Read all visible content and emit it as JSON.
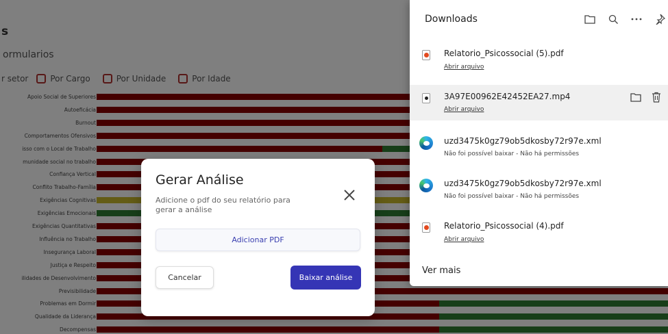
{
  "app": {
    "title": "s",
    "subtitle": "ormularios",
    "filters": [
      "r setor",
      "Por Cargo",
      "Por Unidade",
      "Por Idade"
    ]
  },
  "chart_data": {
    "type": "bar",
    "orientation": "horizontal",
    "stacked": true,
    "categories": [
      "Apoio Social de Superiores",
      "Autoeficácia",
      "Burnout",
      "Comportamentos Ofensivos",
      "isso com o Local de Trabalho",
      "munidade social no trabalho",
      "Confiança Vertical",
      "Conflito Trabalho-Família",
      "Exigências Cognitivas",
      "Exigências Emocionais",
      "Exigências Quantitativas",
      "Influência no Trabalho",
      "Insegurança Laboral",
      "Justiça e Respeito",
      "ilidades de Desenvolvimento",
      "Previsibilidade",
      "Problemas em Dormir",
      "Qualidade da Liderança",
      "Decompensas"
    ],
    "series": [
      {
        "color": "#8b0000",
        "values": [
          1,
          1,
          1,
          1,
          0.5,
          1,
          1,
          1,
          0,
          0,
          1,
          1,
          1,
          1,
          1,
          1,
          0.6,
          0.6,
          0.6
        ]
      },
      {
        "color": "#2e7d32",
        "values": [
          0,
          0,
          0,
          0,
          0.5,
          0,
          0,
          0,
          0,
          1,
          0,
          0,
          0,
          0,
          0,
          0,
          0.4,
          0.4,
          0.4
        ]
      },
      {
        "color": "#c9b92b",
        "values": [
          0,
          0,
          0,
          0,
          0,
          0,
          0,
          0,
          1,
          0,
          0,
          0,
          0,
          0,
          0,
          0,
          0,
          0,
          0
        ]
      }
    ],
    "xlim": [
      0,
      1
    ]
  },
  "modal": {
    "title": "Gerar Análise",
    "description": "Adicione o pdf do seu relatório para gerar a análise",
    "add_pdf": "Adicionar PDF",
    "cancel": "Cancelar",
    "download": "Baixar análise"
  },
  "downloads": {
    "title": "Downloads",
    "items": [
      {
        "name": "Relatorio_Psicossocial (5).pdf",
        "sub": "Abrir arquivo",
        "icon": "pdf-file-icon"
      },
      {
        "name": "3A97E00962E42452EA27.mp4",
        "sub": "Abrir arquivo",
        "icon": "video-file-icon"
      },
      {
        "name": "uzd3475k0gz79ob5dkosby72r97e.xml",
        "sub": "Não foi possível baixar - Não há permissões",
        "icon": "edge-icon"
      },
      {
        "name": "uzd3475k0gz79ob5dkosby72r97e.xml",
        "sub": "Não foi possível baixar - Não há permissões",
        "icon": "edge-icon"
      },
      {
        "name": "Relatorio_Psicossocial (4).pdf",
        "sub": "Abrir arquivo",
        "icon": "pdf-file-icon"
      }
    ],
    "see_more": "Ver mais"
  }
}
